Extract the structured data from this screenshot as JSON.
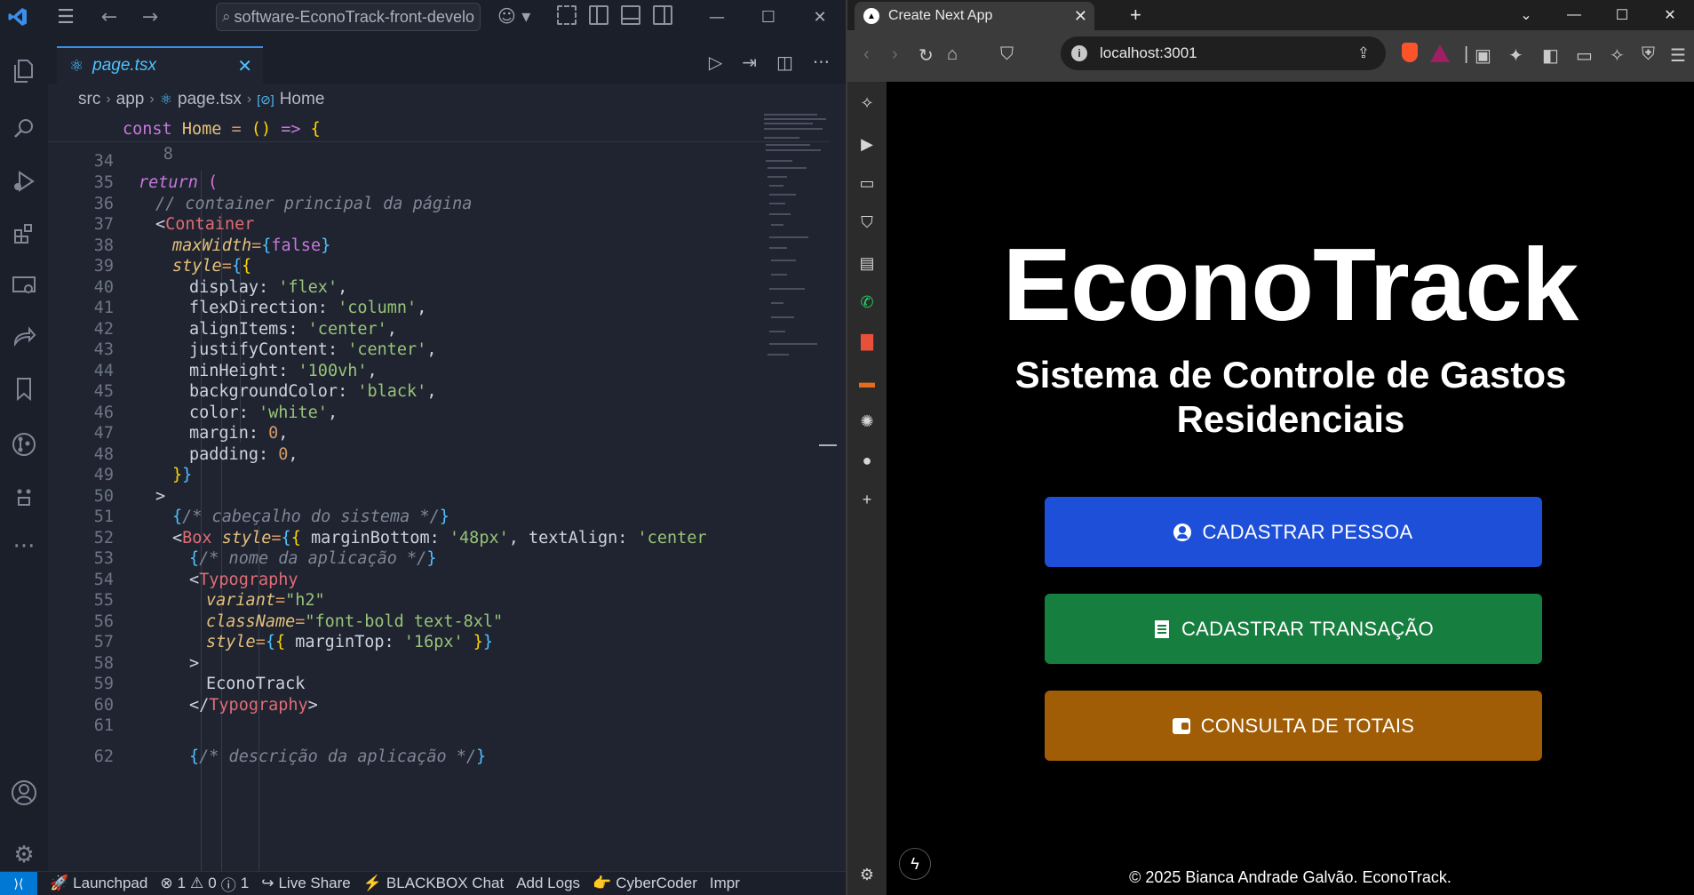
{
  "vscode": {
    "search_text": "software-EconoTrack-front-develo",
    "tab": {
      "label": "page.tsx"
    },
    "breadcrumb": [
      "src",
      "app",
      "page.tsx",
      "Home"
    ],
    "sticky_line": {
      "number": "8"
    },
    "line_numbers": [
      "34",
      "35",
      "36",
      "37",
      "38",
      "39",
      "40",
      "41",
      "42",
      "43",
      "44",
      "45",
      "46",
      "47",
      "48",
      "49",
      "50",
      "51",
      "52",
      "53",
      "54",
      "55",
      "56",
      "57",
      "58",
      "59",
      "60",
      "61",
      "62"
    ],
    "code_text": {
      "home": "Home",
      "return": "return",
      "comment_container": "// container principal da página",
      "container": "Container",
      "maxwidth": "maxWidth",
      "false_val": "false",
      "style": "style",
      "display": "display",
      "flex": "'flex'",
      "flexdirection": "flexDirection",
      "column": "'column'",
      "alignitems": "alignItems",
      "center": "'center'",
      "justifycontent": "justifyContent",
      "minheight": "minHeight",
      "vh": "'100vh'",
      "bgcolor": "backgroundColor",
      "black": "'black'",
      "color": "color",
      "white": "'white'",
      "margin": "margin",
      "padding": "padding",
      "zero": "0",
      "comment_header": "/* cabeçalho do sistema */",
      "box": "Box",
      "marginbottom": "marginBottom",
      "px48": "'48px'",
      "textalign": "textAlign",
      "center_cut": "'center",
      "comment_name": "/* nome da aplicação */",
      "typography": "Typography",
      "variant": "variant",
      "h2": "\"h2\"",
      "classname": "className",
      "classes": "\"font-bold text-8xl\"",
      "margintop": "marginTop",
      "px16": "'16px'",
      "econotrack": "EconoTrack",
      "comment_desc": "/* descrição da aplicação */"
    },
    "statusbar": {
      "launchpad": "Launchpad",
      "errors": "1",
      "warnings": "0",
      "infos": "1",
      "live_share": "Live Share",
      "blackbox": "BLACKBOX Chat",
      "add_logs": "Add Logs",
      "cybercoder": "CyberCoder",
      "impr": "Impr"
    }
  },
  "browser": {
    "tab_title": "Create Next App",
    "url": "localhost:3001",
    "page": {
      "title": "EconoTrack",
      "subtitle": "Sistema de Controle de Gastos Residenciais",
      "buttons": [
        {
          "label": "CADASTRAR PESSOA",
          "icon": "person-circle-icon",
          "color": "#1e4fd8"
        },
        {
          "label": "CADASTRAR TRANSAÇÃO",
          "icon": "receipt-icon",
          "color": "#167f3f"
        },
        {
          "label": "CONSULTA DE TOTAIS",
          "icon": "wallet-icon",
          "color": "#a05d05"
        }
      ],
      "footer": "© 2025 Bianca Andrade Galvão. EconoTrack."
    }
  },
  "colors": {
    "vscode_accent": "#0078d4",
    "page_background": "#000000"
  }
}
